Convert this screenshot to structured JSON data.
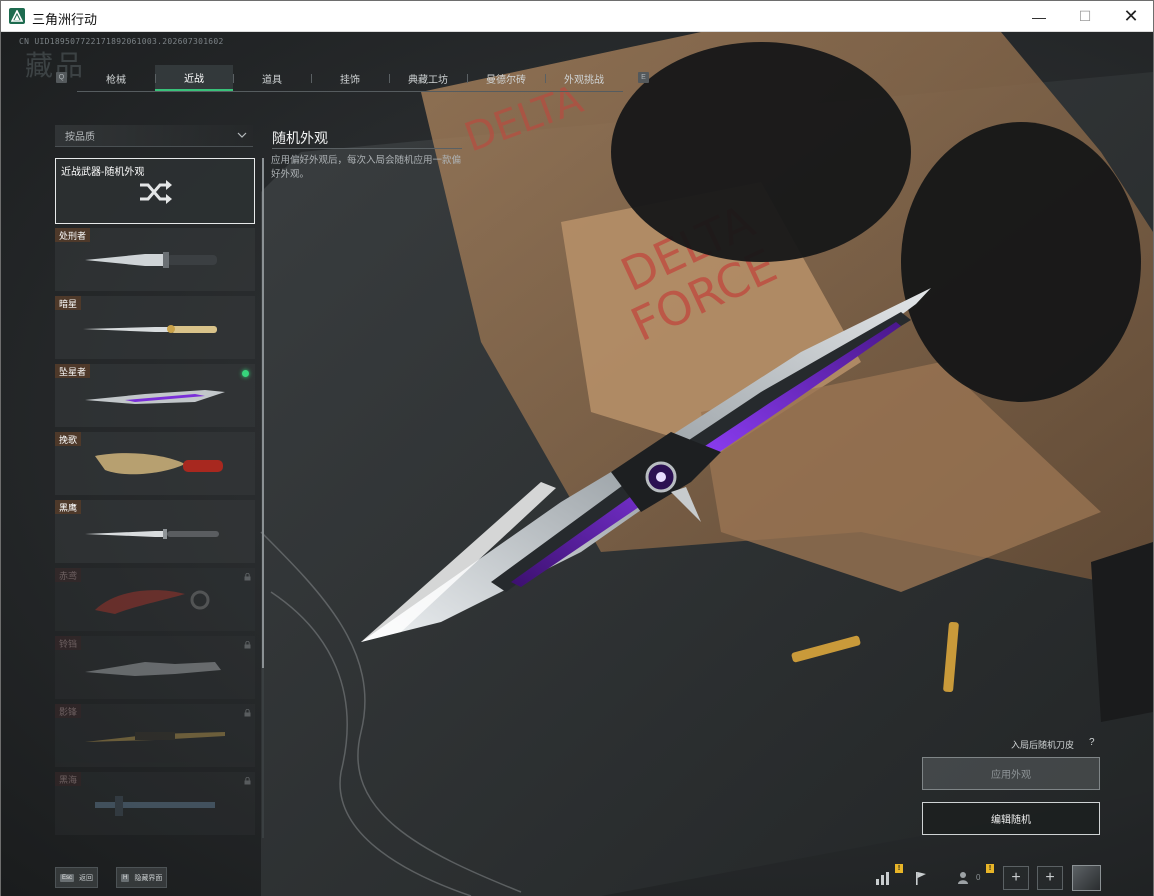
{
  "window": {
    "title": "三角洲行动",
    "min_label": "—",
    "max_label": "☐",
    "close_label": "✕"
  },
  "uid": "CN UID18950772217189206100​3.202607301602",
  "big_mark": "藏品",
  "keys": {
    "prev": "Q",
    "next": "E"
  },
  "tabs": [
    {
      "label": "枪械"
    },
    {
      "label": "近战"
    },
    {
      "label": "道具"
    },
    {
      "label": "挂饰"
    },
    {
      "label": "典藏工坊"
    },
    {
      "label": "曼德尔砖"
    },
    {
      "label": "外观挑战"
    }
  ],
  "filter": {
    "label": "按品质"
  },
  "list": {
    "random_item": {
      "label": "近战武器-随机外观"
    },
    "items": [
      {
        "name": "处刑者",
        "locked": false,
        "equipped": false
      },
      {
        "name": "暗星",
        "locked": false,
        "equipped": false
      },
      {
        "name": "坠星者",
        "locked": false,
        "equipped": true
      },
      {
        "name": "挽歌",
        "locked": false,
        "equipped": false
      },
      {
        "name": "黑鹰",
        "locked": false,
        "equipped": false
      },
      {
        "name": "赤鸢",
        "locked": true,
        "equipped": false
      },
      {
        "name": "铃铛",
        "locked": true,
        "equipped": false
      },
      {
        "name": "影锋",
        "locked": true,
        "equipped": false
      },
      {
        "name": "黑海",
        "locked": true,
        "equipped": false
      }
    ]
  },
  "detail": {
    "title": "随机外观",
    "description": "应用偏好外观后，每次入局会随机应用一款偏好外观。"
  },
  "actions": {
    "random_hint": "入局后随机刀皮",
    "help": "?",
    "apply_label": "应用外观",
    "edit_label": "编辑随机"
  },
  "bottom": {
    "back_key": "Esc",
    "back_label": "返回",
    "hide_key": "H",
    "hide_label": "隐藏界面",
    "badge_1": "!",
    "badge_2": "!",
    "friend_count": "0",
    "plus": "+"
  },
  "colors": {
    "accent": "#39c27a",
    "equipped_dot": "#37d47c",
    "knife_purple": "#7a2ed8"
  }
}
